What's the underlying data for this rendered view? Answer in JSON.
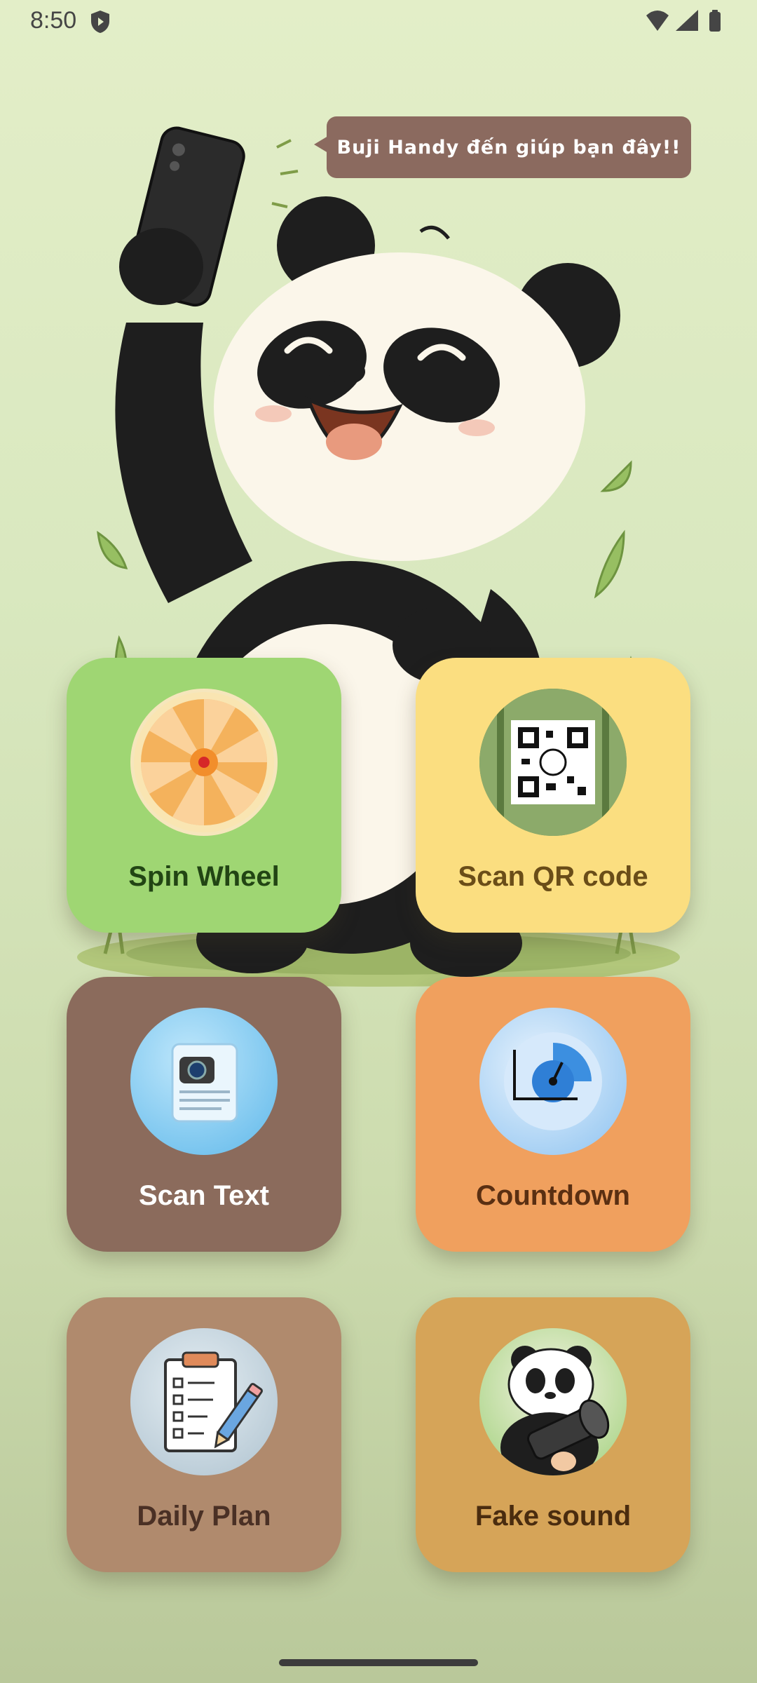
{
  "status_bar": {
    "time": "8:50",
    "icons": [
      "shield-play-icon",
      "wifi-icon",
      "signal-icon",
      "battery-icon"
    ]
  },
  "hero": {
    "speech_bubble": "Buji Handy đến giúp bạn đây!!",
    "illustration": "panda-holding-phone"
  },
  "cards": [
    {
      "label": "Spin Wheel",
      "icon": "spin-wheel-icon",
      "color": "#9fd673"
    },
    {
      "label": "Scan QR code",
      "icon": "qr-code-icon",
      "color": "#fbde80"
    },
    {
      "label": "Scan Text",
      "icon": "document-camera-icon",
      "color": "#8b6b5c"
    },
    {
      "label": "Countdown",
      "icon": "clock-icon",
      "color": "#f0a05e"
    },
    {
      "label": "Daily Plan",
      "icon": "clipboard-checklist-icon",
      "color": "#b08a6d"
    },
    {
      "label": "Fake sound",
      "icon": "panda-megaphone-icon",
      "color": "#d6a458"
    }
  ]
}
